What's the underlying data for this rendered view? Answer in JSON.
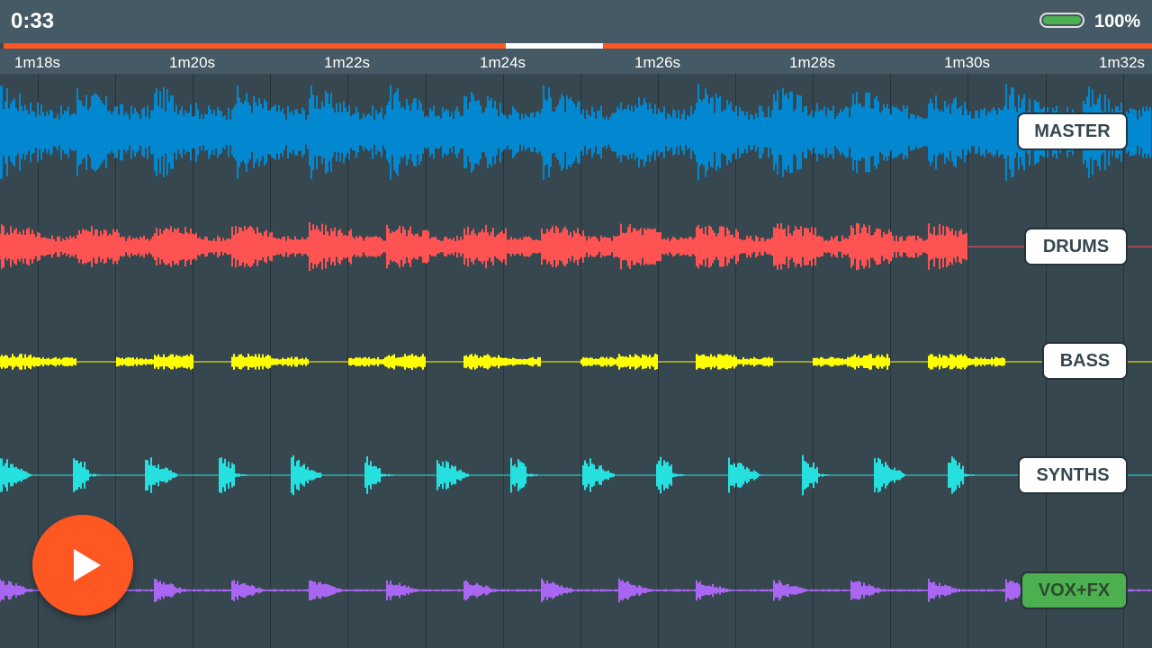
{
  "status": {
    "elapsed": "0:33",
    "battery_percent_label": "100%",
    "battery_level": 1.0,
    "battery_color": "#4caf50"
  },
  "progress": {
    "played_fraction": 0.4373,
    "visible_window_fraction": 0.0846,
    "accent_color": "#ff5722",
    "window_color": "#ffffff"
  },
  "timeline": {
    "ticks": [
      "1m18s",
      "1m20s",
      "1m22s",
      "1m24s",
      "1m26s",
      "1m28s",
      "1m30s",
      "1m32s"
    ]
  },
  "tracks": [
    {
      "label": "MASTER",
      "color": "#0288d1",
      "active": false,
      "end_fraction": 1.0
    },
    {
      "label": "DRUMS",
      "color": "#ff5252",
      "active": false,
      "end_fraction": 0.84
    },
    {
      "label": "BASS",
      "color": "#ffff00",
      "active": false,
      "end_fraction": 1.0
    },
    {
      "label": "SYNTHS",
      "color": "#26e0e0",
      "active": false,
      "end_fraction": 0.86
    },
    {
      "label": "VOX+FX",
      "color": "#a866f2",
      "active": true,
      "end_fraction": 1.0
    }
  ],
  "active_button_color": "#4caf50",
  "controls": {
    "play_icon": "play-icon"
  }
}
